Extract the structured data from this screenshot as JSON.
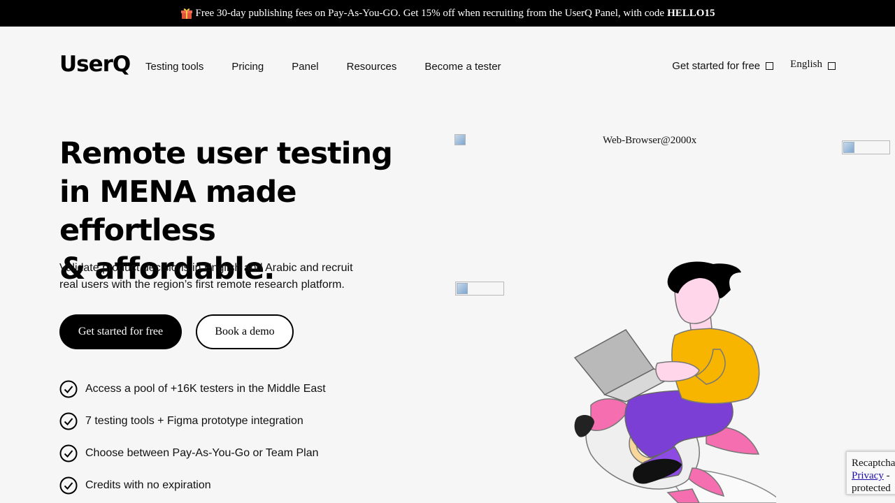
{
  "promo": {
    "icon": "gift-icon",
    "text": "Free 30-day publishing fees on Pay-As-You-GO. Get 15% off when recruiting from the UserQ Panel, with code",
    "code": "HELLO15"
  },
  "header": {
    "logo": "UserQ",
    "nav": [
      "Testing tools",
      "Pricing",
      "Panel",
      "Resources",
      "Become a tester"
    ],
    "get_started": "Get started for free",
    "language": "English"
  },
  "hero": {
    "title_lines": [
      "Remote user testing",
      "in MENA made effortless",
      "& affordable."
    ],
    "subtitle": "Validate product decisions in English and Arabic and recruit real users with the region’s first remote research platform.",
    "primary_cta": "Get started for free",
    "secondary_cta": "Book a demo",
    "features": [
      "Access a pool of +16K testers in the Middle East",
      "7 testing tools + Figma prototype integration",
      "Choose between Pay-As-You-Go or Team Plan",
      "Credits with no expiration"
    ],
    "browser_image_alt": "Web-Browser@2000x"
  },
  "recaptcha": {
    "label": "Recaptcha",
    "privacy_link": "Privacy",
    "separator": " -",
    "protected": "protected"
  },
  "colors": {
    "promo_bg": "#000000",
    "page_bg": "#f6f6f6",
    "primary_btn": "#000000",
    "shirt": "#f7b500",
    "pants": "#7b3fd6",
    "rocket_pink": "#f56fb0"
  }
}
